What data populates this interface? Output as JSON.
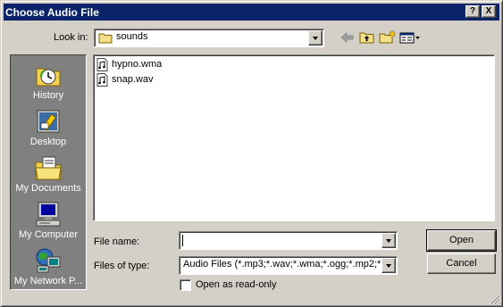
{
  "window": {
    "title": "Choose Audio File",
    "help_label": "?",
    "close_label": "X"
  },
  "toolbar": {
    "look_in_label": "Look in:",
    "look_in_value": "sounds",
    "icons": [
      "back-arrow-icon",
      "up-folder-icon",
      "new-folder-icon",
      "view-menu-icon"
    ]
  },
  "places": [
    {
      "label": "History",
      "icon": "history-icon"
    },
    {
      "label": "Desktop",
      "icon": "desktop-icon"
    },
    {
      "label": "My Documents",
      "icon": "my-documents-icon"
    },
    {
      "label": "My Computer",
      "icon": "my-computer-icon"
    },
    {
      "label": "My Network P...",
      "icon": "my-network-places-icon"
    }
  ],
  "files": [
    {
      "name": "hypno.wma",
      "icon": "audio-file-icon"
    },
    {
      "name": "snap.wav",
      "icon": "audio-file-icon"
    }
  ],
  "form": {
    "file_name_label": "File name:",
    "file_name_value": "",
    "file_type_label": "Files of type:",
    "file_type_value": "Audio Files (*.mp3;*.wav;*.wma;*.ogg;*.mp2;*.mp",
    "read_only_label": "Open as read-only",
    "read_only_checked": false
  },
  "buttons": {
    "open_label": "Open",
    "cancel_label": "Cancel"
  },
  "colors": {
    "titlebar": "#0a246a",
    "face": "#d4d0c8",
    "places_bg": "#808080"
  }
}
